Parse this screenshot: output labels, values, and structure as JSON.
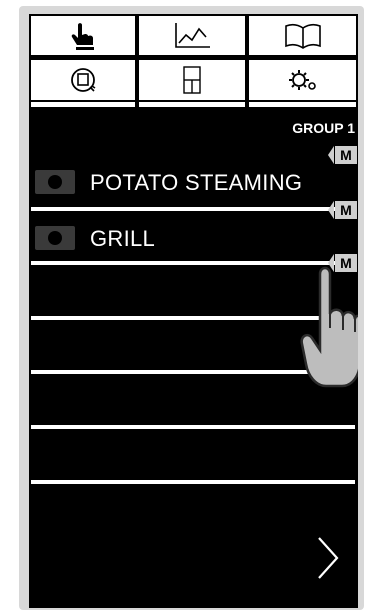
{
  "toolbar": {
    "tabs": [
      {
        "name": "manual-mode-tab",
        "icon": "hand-pointer-icon"
      },
      {
        "name": "automatic-mode-tab",
        "icon": "chart-line-icon"
      },
      {
        "name": "recipe-book-tab",
        "icon": "book-icon"
      },
      {
        "name": "cleaning-tab",
        "icon": "cleaning-cycle-icon"
      },
      {
        "name": "multi-level-tab",
        "icon": "oven-levels-icon"
      },
      {
        "name": "settings-tab",
        "icon": "settings-gears-icon"
      }
    ]
  },
  "group": {
    "title": "GROUP 1"
  },
  "programs": [
    {
      "label": "POTATO STEAMING",
      "badge": "M",
      "icon": "camera-icon"
    },
    {
      "label": "GRILL",
      "badge": "M",
      "icon": "camera-icon"
    },
    {
      "label": "",
      "badge": "M",
      "icon": ""
    },
    {
      "label": "",
      "badge": "",
      "icon": ""
    },
    {
      "label": "",
      "badge": "",
      "icon": ""
    },
    {
      "label": "",
      "badge": "",
      "icon": ""
    },
    {
      "label": "",
      "badge": "",
      "icon": ""
    }
  ],
  "navigation": {
    "next_icon": "chevron-right-icon"
  },
  "overlay": {
    "icon": "pointing-hand-icon"
  },
  "colors": {
    "screen_background": "#000000",
    "tab_background": "#ffffff",
    "badge_background": "#cfcfcf",
    "text": "#ffffff"
  }
}
